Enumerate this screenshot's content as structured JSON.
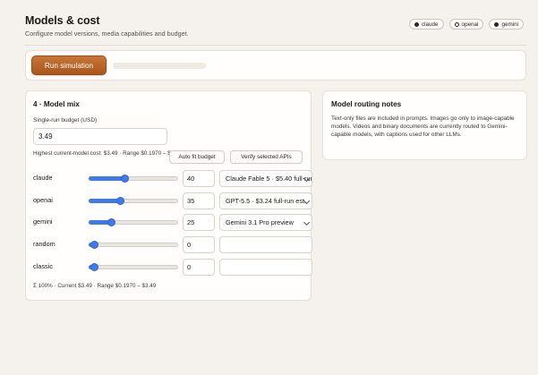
{
  "header": {
    "title": "Models & cost",
    "subtitle": "Configure model versions, media capabilities and budget.",
    "badges": [
      {
        "label": "claude",
        "filled": true
      },
      {
        "label": "openai",
        "filled": false
      },
      {
        "label": "gemini",
        "filled": true
      }
    ]
  },
  "run": {
    "button_label": "Run simulation",
    "progress": 0
  },
  "model_mix": {
    "title": "4 · Model mix",
    "budget_label": "Single-run budget (USD)",
    "budget_value": "3.49",
    "budget_note": "Highest current-model cost: $3.49 · Range $0.1970 – $3.49",
    "auto_fit_label": "Auto fit budget",
    "verify_label": "Verify selected APIs",
    "slider_max": 100,
    "rows": [
      {
        "name": "claude",
        "weight": 40,
        "model": "Claude Fable 5 · $5.40 full-run"
      },
      {
        "name": "openai",
        "weight": 35,
        "model": "GPT-5.5 · $3.24 full-run est."
      },
      {
        "name": "gemini",
        "weight": 25,
        "model": "Gemini 3.1 Pro preview"
      },
      {
        "name": "random",
        "weight": 0,
        "model": ""
      },
      {
        "name": "classic",
        "weight": 0,
        "model": ""
      }
    ],
    "summary": "Σ 100% · Current $3.49 · Range $0.1970 – $3.49"
  },
  "notes": {
    "title": "Model routing notes",
    "body": "Text-only files are included in prompts. Images go only to image-capable models. Videos and binary documents are currently routed to Gemini-capable models, with captions used for other LLMs."
  },
  "colors": {
    "accent": "#a9561d",
    "slider": "#3e7be8",
    "background": "#f5f1ec"
  }
}
